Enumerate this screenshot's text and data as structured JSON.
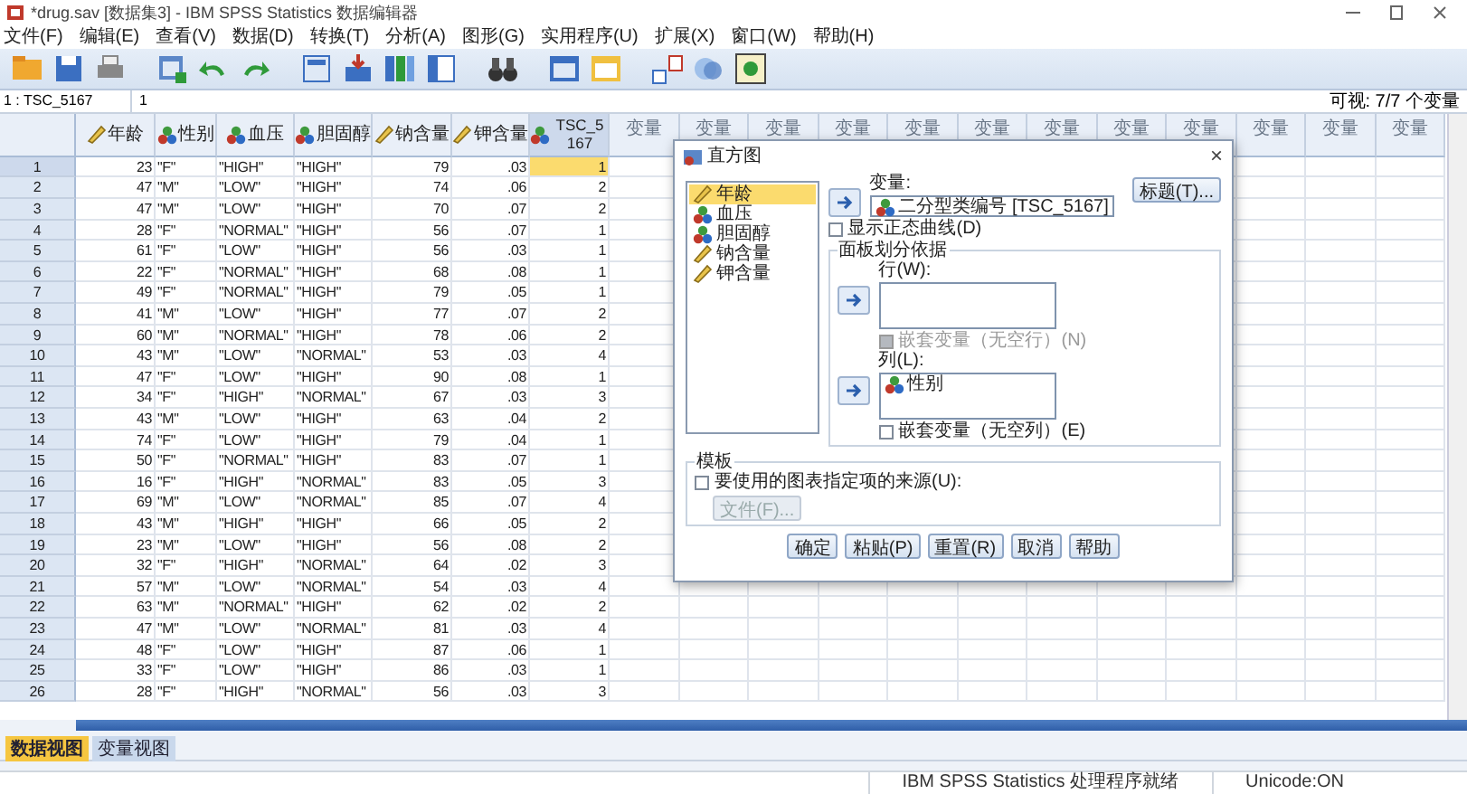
{
  "window": {
    "title": "*drug.sav [数据集3] - IBM SPSS Statistics 数据编辑器"
  },
  "menu": [
    "文件(F)",
    "编辑(E)",
    "查看(V)",
    "数据(D)",
    "转换(T)",
    "分析(A)",
    "图形(G)",
    "实用程序(U)",
    "扩展(X)",
    "窗口(W)",
    "帮助(H)"
  ],
  "cell_editor": {
    "reference": "1 : TSC_5167",
    "value": "1",
    "visible_count": "可视: 7/7 个变量"
  },
  "grid": {
    "columns": [
      {
        "label": "年龄",
        "kind": "scale",
        "selected": false
      },
      {
        "label": "性别",
        "kind": "nominal",
        "selected": false
      },
      {
        "label": "血压",
        "kind": "nominal",
        "selected": false
      },
      {
        "label": "胆固醇",
        "kind": "nominal",
        "selected": false
      },
      {
        "label": "钠含量",
        "kind": "scale",
        "selected": false
      },
      {
        "label": "钾含量",
        "kind": "scale",
        "selected": false
      },
      {
        "label": "TSC_5167",
        "kind": "nominal",
        "selected": true
      }
    ],
    "empty_columns": [
      "变量",
      "变量",
      "变量",
      "变量",
      "变量",
      "变量",
      "变量",
      "变量",
      "变量",
      "变量",
      "变量",
      "变量"
    ],
    "rows": [
      {
        "number": "1",
        "selected": true,
        "cells": [
          "23",
          "\"F\"",
          "\"HIGH\"",
          "\"HIGH\"",
          "79",
          ".03",
          "1"
        ]
      },
      {
        "number": "2",
        "selected": false,
        "cells": [
          "47",
          "\"M\"",
          "\"LOW\"",
          "\"HIGH\"",
          "74",
          ".06",
          "2"
        ]
      },
      {
        "number": "3",
        "selected": false,
        "cells": [
          "47",
          "\"M\"",
          "\"LOW\"",
          "\"HIGH\"",
          "70",
          ".07",
          "2"
        ]
      },
      {
        "number": "4",
        "selected": false,
        "cells": [
          "28",
          "\"F\"",
          "\"NORMAL\"",
          "\"HIGH\"",
          "56",
          ".07",
          "1"
        ]
      },
      {
        "number": "5",
        "selected": false,
        "cells": [
          "61",
          "\"F\"",
          "\"LOW\"",
          "\"HIGH\"",
          "56",
          ".03",
          "1"
        ]
      },
      {
        "number": "6",
        "selected": false,
        "cells": [
          "22",
          "\"F\"",
          "\"NORMAL\"",
          "\"HIGH\"",
          "68",
          ".08",
          "1"
        ]
      },
      {
        "number": "7",
        "selected": false,
        "cells": [
          "49",
          "\"F\"",
          "\"NORMAL\"",
          "\"HIGH\"",
          "79",
          ".05",
          "1"
        ]
      },
      {
        "number": "8",
        "selected": false,
        "cells": [
          "41",
          "\"M\"",
          "\"LOW\"",
          "\"HIGH\"",
          "77",
          ".07",
          "2"
        ]
      },
      {
        "number": "9",
        "selected": false,
        "cells": [
          "60",
          "\"M\"",
          "\"NORMAL\"",
          "\"HIGH\"",
          "78",
          ".06",
          "2"
        ]
      },
      {
        "number": "10",
        "selected": false,
        "cells": [
          "43",
          "\"M\"",
          "\"LOW\"",
          "\"NORMAL\"",
          "53",
          ".03",
          "4"
        ]
      },
      {
        "number": "11",
        "selected": false,
        "cells": [
          "47",
          "\"F\"",
          "\"LOW\"",
          "\"HIGH\"",
          "90",
          ".08",
          "1"
        ]
      },
      {
        "number": "12",
        "selected": false,
        "cells": [
          "34",
          "\"F\"",
          "\"HIGH\"",
          "\"NORMAL\"",
          "67",
          ".03",
          "3"
        ]
      },
      {
        "number": "13",
        "selected": false,
        "cells": [
          "43",
          "\"M\"",
          "\"LOW\"",
          "\"HIGH\"",
          "63",
          ".04",
          "2"
        ]
      },
      {
        "number": "14",
        "selected": false,
        "cells": [
          "74",
          "\"F\"",
          "\"LOW\"",
          "\"HIGH\"",
          "79",
          ".04",
          "1"
        ]
      },
      {
        "number": "15",
        "selected": false,
        "cells": [
          "50",
          "\"F\"",
          "\"NORMAL\"",
          "\"HIGH\"",
          "83",
          ".07",
          "1"
        ]
      },
      {
        "number": "16",
        "selected": false,
        "cells": [
          "16",
          "\"F\"",
          "\"HIGH\"",
          "\"NORMAL\"",
          "83",
          ".05",
          "3"
        ]
      },
      {
        "number": "17",
        "selected": false,
        "cells": [
          "69",
          "\"M\"",
          "\"LOW\"",
          "\"NORMAL\"",
          "85",
          ".07",
          "4"
        ]
      },
      {
        "number": "18",
        "selected": false,
        "cells": [
          "43",
          "\"M\"",
          "\"HIGH\"",
          "\"HIGH\"",
          "66",
          ".05",
          "2"
        ]
      },
      {
        "number": "19",
        "selected": false,
        "cells": [
          "23",
          "\"M\"",
          "\"LOW\"",
          "\"HIGH\"",
          "56",
          ".08",
          "2"
        ]
      },
      {
        "number": "20",
        "selected": false,
        "cells": [
          "32",
          "\"F\"",
          "\"HIGH\"",
          "\"NORMAL\"",
          "64",
          ".02",
          "3"
        ]
      },
      {
        "number": "21",
        "selected": false,
        "cells": [
          "57",
          "\"M\"",
          "\"LOW\"",
          "\"NORMAL\"",
          "54",
          ".03",
          "4"
        ]
      },
      {
        "number": "22",
        "selected": false,
        "cells": [
          "63",
          "\"M\"",
          "\"NORMAL\"",
          "\"HIGH\"",
          "62",
          ".02",
          "2"
        ]
      },
      {
        "number": "23",
        "selected": false,
        "cells": [
          "47",
          "\"M\"",
          "\"LOW\"",
          "\"NORMAL\"",
          "81",
          ".03",
          "4"
        ]
      },
      {
        "number": "24",
        "selected": false,
        "cells": [
          "48",
          "\"F\"",
          "\"LOW\"",
          "\"HIGH\"",
          "87",
          ".06",
          "1"
        ]
      },
      {
        "number": "25",
        "selected": false,
        "cells": [
          "33",
          "\"F\"",
          "\"LOW\"",
          "\"HIGH\"",
          "86",
          ".03",
          "1"
        ]
      },
      {
        "number": "26",
        "selected": false,
        "cells": [
          "28",
          "\"F\"",
          "\"HIGH\"",
          "\"NORMAL\"",
          "56",
          ".03",
          "3"
        ]
      }
    ]
  },
  "dialog": {
    "title": "直方图",
    "close": "×",
    "source_list": [
      {
        "label": "年龄",
        "kind": "scale",
        "selected": true
      },
      {
        "label": "血压",
        "kind": "nominal",
        "selected": false
      },
      {
        "label": "胆固醇",
        "kind": "nominal",
        "selected": false
      },
      {
        "label": "钠含量",
        "kind": "scale",
        "selected": false
      },
      {
        "label": "钾含量",
        "kind": "scale",
        "selected": false
      }
    ],
    "variable": {
      "label": "变量:",
      "value": "二分型类编号 [TSC_5167]",
      "kind": "nominal"
    },
    "titles_button": "标题(T)...",
    "normal_curve": {
      "label": "显示正态曲线(D)",
      "checked": false,
      "disabled": false
    },
    "panel_group": {
      "title": "面板划分依据",
      "rows": {
        "label": "行(W):"
      },
      "rows_nest": {
        "label": "嵌套变量（无空行）(N)",
        "checked": false,
        "disabled": true
      },
      "columns": {
        "label": "列(L):",
        "items": [
          {
            "label": "性别",
            "kind": "nominal"
          }
        ]
      },
      "columns_nest": {
        "label": "嵌套变量（无空列）(E)",
        "checked": false,
        "disabled": false
      }
    },
    "template_group": {
      "title": "模板",
      "use_template": {
        "label": "要使用的图表指定项的来源(U):",
        "checked": false,
        "disabled": false
      },
      "file_button": {
        "label": "文件(F)...",
        "disabled": true
      }
    },
    "buttons": [
      "确定",
      "粘贴(P)",
      "重置(R)",
      "取消",
      "帮助"
    ]
  },
  "view_tabs": [
    {
      "label": "数据视图",
      "selected": true
    },
    {
      "label": "变量视图",
      "selected": false
    }
  ],
  "status_bar": [
    "IBM SPSS Statistics 处理程序就绪",
    "Unicode:ON"
  ]
}
